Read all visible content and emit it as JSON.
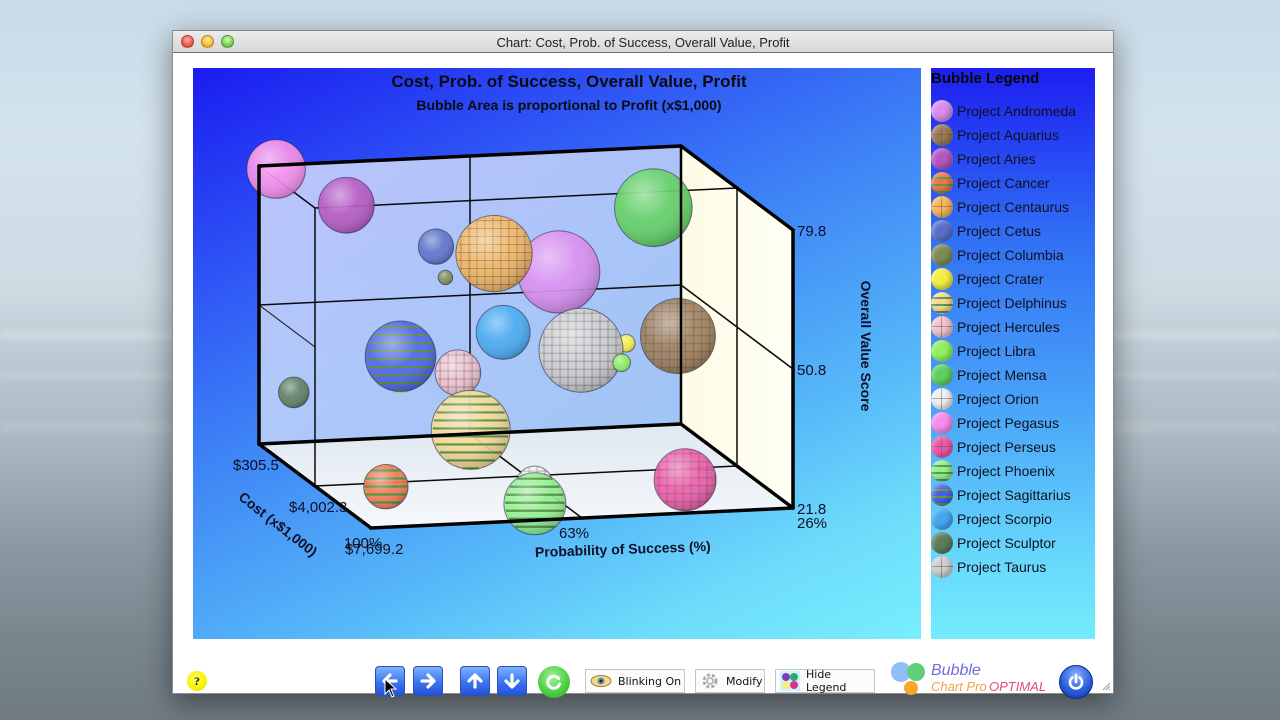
{
  "window": {
    "title": "Chart: Cost, Prob. of Success, Overall Value, Profit"
  },
  "chart_data": {
    "type": "bubble3d",
    "title": "Cost, Prob. of Success, Overall Value, Profit",
    "subtitle": "Bubble Area is proportional to Profit (x$1,000)",
    "axes": {
      "x": {
        "label": "Probability of Success (%)",
        "range": [
          26,
          100
        ],
        "reversed": true,
        "ticks": [
          "100%",
          "63%",
          "26%"
        ]
      },
      "y": {
        "label": "Overall Value Score",
        "range": [
          21.8,
          79.8
        ],
        "ticks": [
          "21.8",
          "50.8",
          "79.8"
        ]
      },
      "z": {
        "label": "Cost (x$1,000)",
        "range": [
          305.5,
          7699.2
        ],
        "ticks": [
          "$305.5",
          "$4,002.3",
          "$7,699.2"
        ]
      }
    },
    "size_label": "Profit (x$1,000)",
    "series": [
      {
        "name": "Project Andromeda",
        "prob": 53,
        "cost": 2400,
        "value": 60,
        "profit": 650,
        "color": "#d98cf0",
        "pattern": "none"
      },
      {
        "name": "Project Aquarius",
        "prob": 39,
        "cost": 5000,
        "value": 52,
        "profit": 540,
        "color": "#9c7a55",
        "pattern": "grid"
      },
      {
        "name": "Project Aries",
        "prob": 86,
        "cost": 800,
        "value": 72,
        "profit": 300,
        "color": "#b455c0",
        "pattern": "none"
      },
      {
        "name": "Project Cancer",
        "prob": 95,
        "cost": 6800,
        "value": 28,
        "profit": 190,
        "color": "#f0754a",
        "pattern": "stripes"
      },
      {
        "name": "Project Centaurus",
        "prob": 67,
        "cost": 3400,
        "value": 67,
        "profit": 560,
        "color": "#f5b55a",
        "pattern": "grid"
      },
      {
        "name": "Project Cetus",
        "prob": 74,
        "cost": 2200,
        "value": 66,
        "profit": 120,
        "color": "#5a70c8",
        "pattern": "none"
      },
      {
        "name": "Project Columbia",
        "prob": 75,
        "cost": 3200,
        "value": 62,
        "profit": 20,
        "color": "#7f8a55",
        "pattern": "none"
      },
      {
        "name": "Project Crater",
        "prob": 47,
        "cost": 4600,
        "value": 50,
        "profit": 30,
        "color": "#f5ee40",
        "pattern": "none"
      },
      {
        "name": "Project Delphinus",
        "prob": 78,
        "cost": 6000,
        "value": 37,
        "profit": 600,
        "color": "#f8d890",
        "pattern": "stripes"
      },
      {
        "name": "Project Hercules",
        "prob": 76,
        "cost": 4400,
        "value": 45,
        "profit": 200,
        "color": "#f2c2cc",
        "pattern": "grid"
      },
      {
        "name": "Project Libra",
        "prob": 51,
        "cost": 5800,
        "value": 49,
        "profit": 30,
        "color": "#8ff060",
        "pattern": "none"
      },
      {
        "name": "Project Mensa",
        "prob": 38,
        "cost": 3000,
        "value": 74,
        "profit": 580,
        "color": "#5fd060",
        "pattern": "none"
      },
      {
        "name": "Project Orion",
        "prob": 70,
        "cost": 7200,
        "value": 28,
        "profit": 130,
        "color": "#f0f0f2",
        "pattern": "grid"
      },
      {
        "name": "Project Pegasus",
        "prob": 97,
        "cost": 305.5,
        "value": 79,
        "profit": 330,
        "color": "#f58cec",
        "pattern": "none"
      },
      {
        "name": "Project Perseus",
        "prob": 42,
        "cost": 6600,
        "value": 26,
        "profit": 370,
        "color": "#f055a8",
        "pattern": "grid"
      },
      {
        "name": "Project Phoenix",
        "prob": 71,
        "cost": 7600,
        "value": 25,
        "profit": 370,
        "color": "#8ff08c",
        "pattern": "stripes"
      },
      {
        "name": "Project Sagittarius",
        "prob": 85,
        "cost": 4000,
        "value": 48,
        "profit": 480,
        "color": "#4b5ee8",
        "pattern": "stripes"
      },
      {
        "name": "Project Scorpio",
        "prob": 67,
        "cost": 4000,
        "value": 52,
        "profit": 280,
        "color": "#44a8f0",
        "pattern": "none"
      },
      {
        "name": "Project Sculptor",
        "prob": 100,
        "cost": 2600,
        "value": 38,
        "profit": 90,
        "color": "#5c7c5c",
        "pattern": "none"
      },
      {
        "name": "Project Taurus",
        "prob": 56,
        "cost": 5000,
        "value": 50,
        "profit": 680,
        "color": "#cfcfcf",
        "pattern": "grid"
      }
    ]
  },
  "legend": {
    "title": "Bubble Legend"
  },
  "toolbar": {
    "help_label": "?",
    "blinking_label": "Blinking On",
    "modify_label": "Modify",
    "hide_legend_label": "Hide Legend",
    "brand_line1": "Bubble",
    "brand_line2": "Chart Pro",
    "brand_line3": "OPTIMAL"
  }
}
